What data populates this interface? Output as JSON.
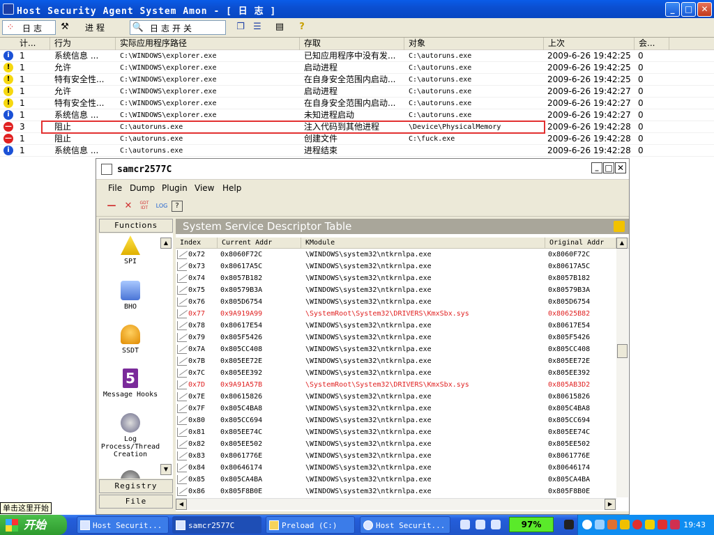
{
  "main_window": {
    "title": "Host Security Agent System Amon - [ 日 志 ]",
    "controls": {
      "minimize": "_",
      "maximize": "□",
      "close": "✕"
    }
  },
  "toolbar": {
    "log_tab": "日志",
    "process_tab": "进程",
    "log_switch": "日志开关",
    "icons": [
      "log-view-icon",
      "process-icon",
      "search-icon",
      "cascade-icon",
      "tile-icon",
      "properties-icon",
      "help-icon"
    ]
  },
  "log_list": {
    "columns": [
      "计...",
      "行为",
      "实际应用程序路径",
      "存取",
      "对象",
      "上次",
      "会..."
    ],
    "rows": [
      {
        "icon": "info",
        "count": "1",
        "action": "系统信息 ...",
        "path": "C:\\WINDOWS\\explorer.exe",
        "access": "已知应用程序中没有发...",
        "object": "C:\\autoruns.exe",
        "time": "2009-6-26 19:42:25",
        "session": "0"
      },
      {
        "icon": "warn",
        "count": "1",
        "action": "允许",
        "path": "C:\\WINDOWS\\explorer.exe",
        "access": "启动进程",
        "object": "C:\\autoruns.exe",
        "time": "2009-6-26 19:42:25",
        "session": "0"
      },
      {
        "icon": "warn",
        "count": "1",
        "action": "特有安全性...",
        "path": "C:\\WINDOWS\\explorer.exe",
        "access": "在自身安全范围内启动...",
        "object": "C:\\autoruns.exe",
        "time": "2009-6-26 19:42:25",
        "session": "0"
      },
      {
        "icon": "warn",
        "count": "1",
        "action": "允许",
        "path": "C:\\WINDOWS\\explorer.exe",
        "access": "启动进程",
        "object": "C:\\autoruns.exe",
        "time": "2009-6-26 19:42:27",
        "session": "0"
      },
      {
        "icon": "warn",
        "count": "1",
        "action": "特有安全性...",
        "path": "C:\\WINDOWS\\explorer.exe",
        "access": "在自身安全范围内启动...",
        "object": "C:\\autoruns.exe",
        "time": "2009-6-26 19:42:27",
        "session": "0"
      },
      {
        "icon": "info",
        "count": "1",
        "action": "系统信息 ...",
        "path": "C:\\WINDOWS\\explorer.exe",
        "access": "未知进程启动",
        "object": "C:\\autoruns.exe",
        "time": "2009-6-26 19:42:27",
        "session": "0"
      },
      {
        "icon": "stop",
        "count": "3",
        "action": "阻止",
        "path": "C:\\autoruns.exe",
        "access": "注入代码到其他进程",
        "object": "\\Device\\PhysicalMemory",
        "time": "2009-6-26 19:42:28",
        "session": "0"
      },
      {
        "icon": "stop",
        "count": "1",
        "action": "阻止",
        "path": "C:\\autoruns.exe",
        "access": "创建文件",
        "object": "C:\\fuck.exe",
        "time": "2009-6-26 19:42:28",
        "session": "0"
      },
      {
        "icon": "info",
        "count": "1",
        "action": "系统信息 ...",
        "path": "C:\\autoruns.exe",
        "access": "进程结束",
        "object": "",
        "time": "2009-6-26 19:42:28",
        "session": "0"
      }
    ]
  },
  "child_window": {
    "title": "samcr2577C",
    "menu": [
      "File",
      "Dump",
      "Plugin",
      "View",
      "Help"
    ],
    "toolbar_icons": [
      "minus-icon",
      "delete-icon",
      "gdt-idt-icon",
      "log-icon",
      "help-icon"
    ],
    "toolbar_labels": {
      "gdt": "GDT IDT",
      "log": "LOG"
    },
    "functions_header": "Functions",
    "functions": [
      {
        "label": "SPI",
        "icon": "warning-icon"
      },
      {
        "label": "BHO",
        "icon": "bho-icon"
      },
      {
        "label": "SSDT",
        "icon": "bell-icon"
      },
      {
        "label": "Message Hooks",
        "icon": "hook-icon"
      },
      {
        "label": "Log Process/Thread Creation",
        "icon": "log-process-icon"
      }
    ],
    "footer_tabs": [
      "Registry",
      "File"
    ],
    "panel_title": "System Service Descriptor Table",
    "table": {
      "columns": [
        "Index",
        "Current Addr",
        "KModule",
        "Original Addr"
      ],
      "rows": [
        {
          "index": "0x72",
          "current": "0x8060F72C",
          "module": "\\WINDOWS\\system32\\ntkrnlpa.exe",
          "original": "0x8060F72C",
          "hooked": false
        },
        {
          "index": "0x73",
          "current": "0x80617A5C",
          "module": "\\WINDOWS\\system32\\ntkrnlpa.exe",
          "original": "0x80617A5C",
          "hooked": false
        },
        {
          "index": "0x74",
          "current": "0x8057B182",
          "module": "\\WINDOWS\\system32\\ntkrnlpa.exe",
          "original": "0x8057B182",
          "hooked": false
        },
        {
          "index": "0x75",
          "current": "0x80579B3A",
          "module": "\\WINDOWS\\system32\\ntkrnlpa.exe",
          "original": "0x80579B3A",
          "hooked": false
        },
        {
          "index": "0x76",
          "current": "0x805D6754",
          "module": "\\WINDOWS\\system32\\ntkrnlpa.exe",
          "original": "0x805D6754",
          "hooked": false
        },
        {
          "index": "0x77",
          "current": "0x9A919A99",
          "module": "\\SystemRoot\\System32\\DRIVERS\\KmxSbx.sys",
          "original": "0x80625B82",
          "hooked": true
        },
        {
          "index": "0x78",
          "current": "0x80617E54",
          "module": "\\WINDOWS\\system32\\ntkrnlpa.exe",
          "original": "0x80617E54",
          "hooked": false
        },
        {
          "index": "0x79",
          "current": "0x805F5426",
          "module": "\\WINDOWS\\system32\\ntkrnlpa.exe",
          "original": "0x805F5426",
          "hooked": false
        },
        {
          "index": "0x7A",
          "current": "0x805CC408",
          "module": "\\WINDOWS\\system32\\ntkrnlpa.exe",
          "original": "0x805CC408",
          "hooked": false
        },
        {
          "index": "0x7B",
          "current": "0x805EE72E",
          "module": "\\WINDOWS\\system32\\ntkrnlpa.exe",
          "original": "0x805EE72E",
          "hooked": false
        },
        {
          "index": "0x7C",
          "current": "0x805EE392",
          "module": "\\WINDOWS\\system32\\ntkrnlpa.exe",
          "original": "0x805EE392",
          "hooked": false
        },
        {
          "index": "0x7D",
          "current": "0x9A91A57B",
          "module": "\\SystemRoot\\System32\\DRIVERS\\KmxSbx.sys",
          "original": "0x805AB3D2",
          "hooked": true
        },
        {
          "index": "0x7E",
          "current": "0x80615826",
          "module": "\\WINDOWS\\system32\\ntkrnlpa.exe",
          "original": "0x80615826",
          "hooked": false
        },
        {
          "index": "0x7F",
          "current": "0x805C4BA8",
          "module": "\\WINDOWS\\system32\\ntkrnlpa.exe",
          "original": "0x805C4BA8",
          "hooked": false
        },
        {
          "index": "0x80",
          "current": "0x805CC694",
          "module": "\\WINDOWS\\system32\\ntkrnlpa.exe",
          "original": "0x805CC694",
          "hooked": false
        },
        {
          "index": "0x81",
          "current": "0x805EE74C",
          "module": "\\WINDOWS\\system32\\ntkrnlpa.exe",
          "original": "0x805EE74C",
          "hooked": false
        },
        {
          "index": "0x82",
          "current": "0x805EE502",
          "module": "\\WINDOWS\\system32\\ntkrnlpa.exe",
          "original": "0x805EE502",
          "hooked": false
        },
        {
          "index": "0x83",
          "current": "0x8061776E",
          "module": "\\WINDOWS\\system32\\ntkrnlpa.exe",
          "original": "0x8061776E",
          "hooked": false
        },
        {
          "index": "0x84",
          "current": "0x80646174",
          "module": "\\WINDOWS\\system32\\ntkrnlpa.exe",
          "original": "0x80646174",
          "hooked": false
        },
        {
          "index": "0x85",
          "current": "0x805CA4BA",
          "module": "\\WINDOWS\\system32\\ntkrnlpa.exe",
          "original": "0x805CA4BA",
          "hooked": false
        },
        {
          "index": "0x86",
          "current": "0x805F8B0E",
          "module": "\\WINDOWS\\system32\\ntkrnlpa.exe",
          "original": "0x805F8B0E",
          "hooked": false
        }
      ]
    }
  },
  "tooltip": "单击这里开始",
  "taskbar": {
    "start_label": "开始",
    "tasks": [
      {
        "label": "Host Securit...",
        "active": false
      },
      {
        "label": "samcr2577C",
        "active": true
      },
      {
        "label": "Preload (C:)",
        "active": false
      },
      {
        "label": "Host Securit...",
        "active": false
      }
    ],
    "progress": "97%",
    "clock": "19:43"
  },
  "colors": {
    "title_blue": "#0b4fd1",
    "hooked_red": "#e02020",
    "highlight_border": "#e23030",
    "progress_green": "#5aea2a"
  }
}
